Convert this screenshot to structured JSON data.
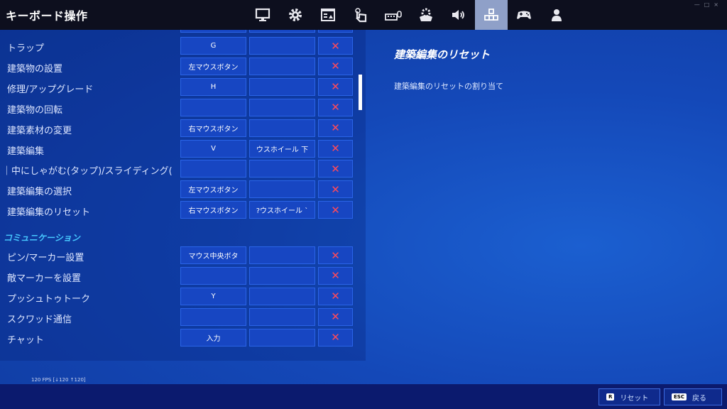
{
  "header": {
    "title": "キーボード操作",
    "tabs": [
      {
        "icon": "monitor-icon",
        "active": false
      },
      {
        "icon": "gear-icon",
        "active": false
      },
      {
        "icon": "game-ui-icon",
        "active": false
      },
      {
        "icon": "touch-icon",
        "active": false
      },
      {
        "icon": "keyboard-mouse-icon",
        "active": false
      },
      {
        "icon": "controller-settings-icon",
        "active": false
      },
      {
        "icon": "speaker-icon",
        "active": false
      },
      {
        "icon": "keybind-icon",
        "active": true
      },
      {
        "icon": "gamepad-icon",
        "active": false
      },
      {
        "icon": "account-icon",
        "active": false
      }
    ]
  },
  "bindings": {
    "rows": [
      {
        "label": "トラップ",
        "key1": "G",
        "key2": "",
        "remove": "✕"
      },
      {
        "label": "建築物の設置",
        "key1": "左マウスボタン",
        "key2": "",
        "remove": "✕"
      },
      {
        "label": "修理/アップグレード",
        "key1": "H",
        "key2": "",
        "remove": "✕"
      },
      {
        "label": "建築物の回転",
        "key1": "",
        "key2": "",
        "remove": "✕"
      },
      {
        "label": "建築素材の変更",
        "key1": "右マウスボタン",
        "key2": "",
        "remove": "✕"
      },
      {
        "label": "建築編集",
        "key1": "V",
        "key2": "ウスホイール 下",
        "remove": "✕"
      },
      {
        "label": "｜中にしゃがむ(タップ)/スライディング(長押",
        "key1": "",
        "key2": "",
        "remove": "✕"
      },
      {
        "label": "建築編集の選択",
        "key1": "左マウスボタン",
        "key2": "",
        "remove": "✕"
      },
      {
        "label": "建築編集のリセット",
        "key1": "右マウスボタン",
        "key2": "?ウスホイール `",
        "remove": "✕"
      }
    ],
    "section_communication": "コミュニケーション",
    "comm_rows": [
      {
        "label": "ピン/マーカー設置",
        "key1": "マウス中央ボタ",
        "key2": "",
        "remove": "✕"
      },
      {
        "label": "敵マーカーを設置",
        "key1": "",
        "key2": "",
        "remove": "✕"
      },
      {
        "label": "プッシュトゥトーク",
        "key1": "Y",
        "key2": "",
        "remove": "✕"
      },
      {
        "label": "スクワッド通信",
        "key1": "",
        "key2": "",
        "remove": "✕"
      },
      {
        "label": "チャット",
        "key1": "入力",
        "key2": "",
        "remove": "✕"
      }
    ]
  },
  "detail": {
    "title": "建築編集のリセット",
    "description": "建築編集のリセットの割り当て"
  },
  "status": {
    "fps": "120 FPS [↓120 ↑120]"
  },
  "footer": {
    "reset_key": "R",
    "reset_label": "リセット",
    "back_key": "ESC",
    "back_label": "戻る"
  },
  "colors": {
    "accent": "#47c8ff",
    "remove": "#ff4a5a",
    "active_tab": "#8fa0c8"
  }
}
